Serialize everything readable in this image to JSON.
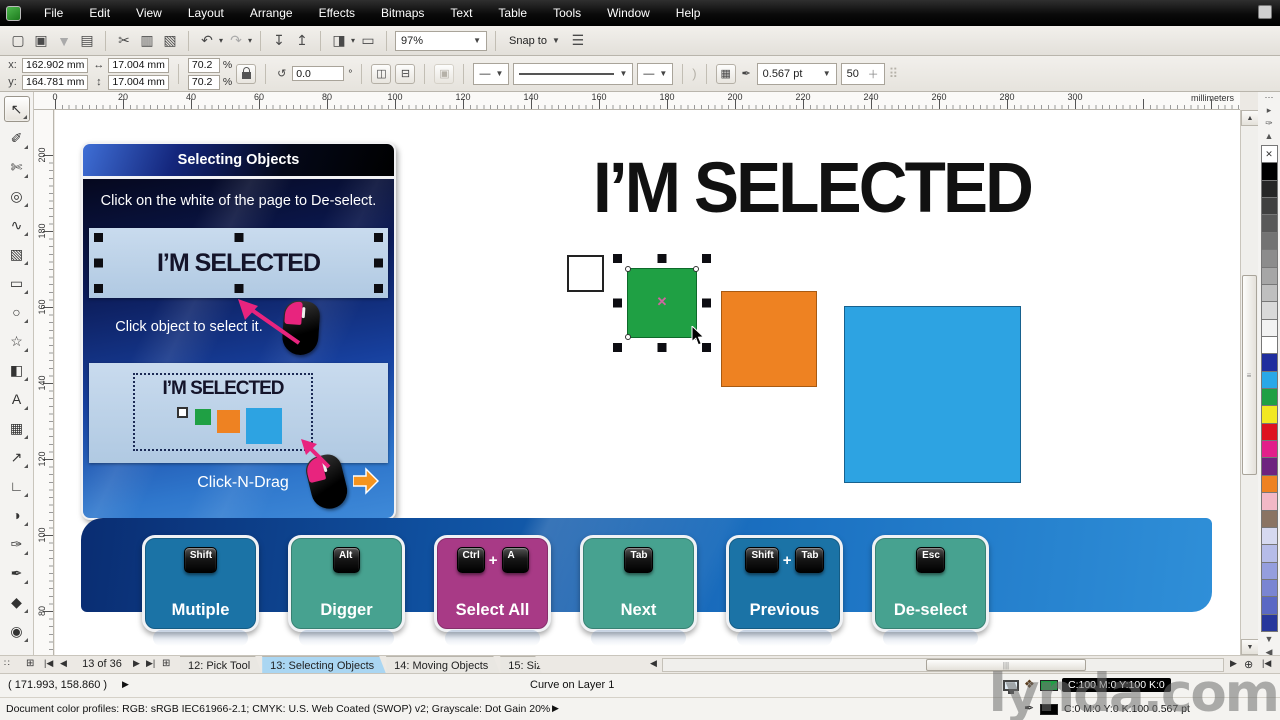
{
  "menu": {
    "items": [
      "File",
      "Edit",
      "View",
      "Layout",
      "Arrange",
      "Effects",
      "Bitmaps",
      "Text",
      "Table",
      "Tools",
      "Window",
      "Help"
    ]
  },
  "toolbar": {
    "zoom_value": "97%",
    "snap_label": "Snap to"
  },
  "property_bar": {
    "x_label": "x:",
    "y_label": "y:",
    "x_value": "162.902 mm",
    "y_value": "164.781 mm",
    "w_value": "17.004 mm",
    "h_value": "17.004 mm",
    "scale_x": "70.2",
    "scale_y": "70.2",
    "percent": "%",
    "rotation_value": "0.0",
    "degree": "°",
    "outline_width": "0.567 pt",
    "stepper_value": "50"
  },
  "rulers": {
    "h_labels": [
      "0",
      "20",
      "40",
      "60",
      "80",
      "100",
      "120",
      "140",
      "160",
      "180",
      "200",
      "220",
      "240",
      "260",
      "280",
      "300"
    ],
    "unit": "millimeters",
    "v_labels": [
      "200",
      "180",
      "160",
      "140",
      "120",
      "100",
      "80"
    ]
  },
  "toolbox": {
    "tools": [
      {
        "name": "pick-tool",
        "glyph": "↖"
      },
      {
        "name": "shape-tool",
        "glyph": "✐"
      },
      {
        "name": "crop-tool",
        "glyph": "✄"
      },
      {
        "name": "zoom-tool",
        "glyph": "◎"
      },
      {
        "name": "freehand-tool",
        "glyph": "∿"
      },
      {
        "name": "smart-fill-tool",
        "glyph": "▧"
      },
      {
        "name": "rectangle-tool",
        "glyph": "▭"
      },
      {
        "name": "ellipse-tool",
        "glyph": "○"
      },
      {
        "name": "polygon-tool",
        "glyph": "☆"
      },
      {
        "name": "basic-shapes-tool",
        "glyph": "◧"
      },
      {
        "name": "text-tool",
        "glyph": "A"
      },
      {
        "name": "table-tool",
        "glyph": "▦"
      },
      {
        "name": "dimension-tool",
        "glyph": "↗"
      },
      {
        "name": "connector-tool",
        "glyph": "∟"
      },
      {
        "name": "blend-tool",
        "glyph": "◑"
      },
      {
        "name": "eyedropper-tool",
        "glyph": "✑"
      },
      {
        "name": "outline-pen-tool",
        "glyph": "✒"
      },
      {
        "name": "fill-tool",
        "glyph": "◆"
      },
      {
        "name": "interactive-fill-tool",
        "glyph": "◉"
      }
    ]
  },
  "canvas": {
    "headline": "I’M SELECTED",
    "panel": {
      "title": "Selecting Objects",
      "instruction1": "Click on the white of the page to De-select.",
      "selected_label": "I’M SELECTED",
      "instruction2": "Click object to select it.",
      "marquee_label": "I’M SELECTED",
      "instruction3": "Click-N-Drag"
    },
    "plus": "+",
    "buttons": [
      {
        "label": "Mutiple",
        "keys": [
          "Shift"
        ],
        "color": "#1b73a6"
      },
      {
        "label": "Digger",
        "keys": [
          "Alt"
        ],
        "color": "#47a290"
      },
      {
        "label": "Select All",
        "keys": [
          "Ctrl",
          "A"
        ],
        "color": "#a83a86"
      },
      {
        "label": "Next",
        "keys": [
          "Tab"
        ],
        "color": "#47a290"
      },
      {
        "label": "Previous",
        "keys": [
          "Shift",
          "Tab"
        ],
        "color": "#1b73a6"
      },
      {
        "label": "De-select",
        "keys": [
          "Esc"
        ],
        "color": "#47a290"
      }
    ],
    "shape_colors": {
      "green": "#1fa044",
      "orange": "#ee8222",
      "blue": "#2da3e2",
      "white": "#ffffff"
    }
  },
  "palette": {
    "colors": [
      "none",
      "#000000",
      "#262626",
      "#404040",
      "#595959",
      "#737373",
      "#8c8c8c",
      "#a6a6a6",
      "#bfbfbf",
      "#d9d9d9",
      "#f2f2f2",
      "#ffffff",
      "#202e9e",
      "#29a8e8",
      "#1fa044",
      "#f2e822",
      "#de1220",
      "#e21f8a",
      "#6e2380",
      "#ee8222",
      "#f2b8c6",
      "#8a7463",
      "#d6d9f0",
      "#b6bce8",
      "#959ede",
      "#7a85d2",
      "#5a68c4",
      "#27379c"
    ]
  },
  "page_nav": {
    "position": "13 of 36"
  },
  "tabs": [
    {
      "label": "12: Pick Tool"
    },
    {
      "label": "13: Selecting Objects"
    },
    {
      "label": "14: Moving Objects"
    },
    {
      "label": "15: Siz"
    }
  ],
  "status": {
    "coords": "( 171.993, 158.860 )",
    "object_info": "Curve on Layer 1",
    "fill_value": "C:100 M:0 Y:100 K:0",
    "outline_value": "C:0 M:0 Y:0 K:100  0.567 pt",
    "profiles": "Document color profiles: RGB: sRGB IEC61966-2.1; CMYK: U.S. Web Coated (SWOP) v2; Grayscale: Dot Gain 20%",
    "arrow": "▶"
  },
  "watermark": "lynda.com"
}
